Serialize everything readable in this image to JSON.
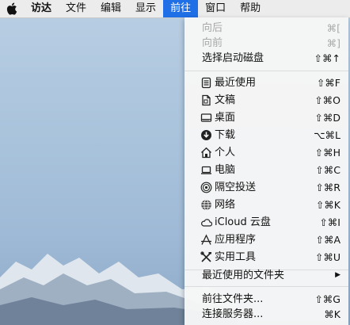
{
  "menubar": {
    "items": [
      {
        "label": "访达"
      },
      {
        "label": "文件"
      },
      {
        "label": "编辑"
      },
      {
        "label": "显示"
      },
      {
        "label": "前往"
      },
      {
        "label": "窗口"
      },
      {
        "label": "帮助"
      }
    ]
  },
  "go_menu": {
    "back": {
      "label": "向后",
      "shortcut": "⌘["
    },
    "forward": {
      "label": "向前",
      "shortcut": "⌘]"
    },
    "startup_disk": {
      "label": "选择启动磁盘",
      "shortcut": "⇧⌘↑"
    },
    "recents": {
      "label": "最近使用",
      "shortcut": "⇧⌘F",
      "icon": "recents-icon"
    },
    "documents": {
      "label": "文稿",
      "shortcut": "⇧⌘O",
      "icon": "documents-icon"
    },
    "desktop": {
      "label": "桌面",
      "shortcut": "⇧⌘D",
      "icon": "desktop-icon"
    },
    "downloads": {
      "label": "下载",
      "shortcut": "⌥⌘L",
      "icon": "downloads-icon"
    },
    "home": {
      "label": "个人",
      "shortcut": "⇧⌘H",
      "icon": "home-icon"
    },
    "computer": {
      "label": "电脑",
      "shortcut": "⇧⌘C",
      "icon": "computer-icon"
    },
    "airdrop": {
      "label": "隔空投送",
      "shortcut": "⇧⌘R",
      "icon": "airdrop-icon"
    },
    "network": {
      "label": "网络",
      "shortcut": "⇧⌘K",
      "icon": "network-icon"
    },
    "icloud": {
      "label": "iCloud 云盘",
      "shortcut": "⇧⌘I",
      "icon": "icloud-icon"
    },
    "applications": {
      "label": "应用程序",
      "shortcut": "⇧⌘A",
      "icon": "applications-icon"
    },
    "utilities": {
      "label": "实用工具",
      "shortcut": "⇧⌘U",
      "icon": "utilities-icon"
    },
    "recent_folders": {
      "label": "最近使用的文件夹",
      "submenu_arrow": "▶"
    },
    "go_to_folder": {
      "label": "前往文件夹...",
      "shortcut": "⇧⌘G"
    },
    "connect_server": {
      "label": "连接服务器...",
      "shortcut": "⌘K"
    }
  },
  "colors": {
    "active_menu": "#1f6fe6",
    "menubar_bg": "#ececec"
  }
}
